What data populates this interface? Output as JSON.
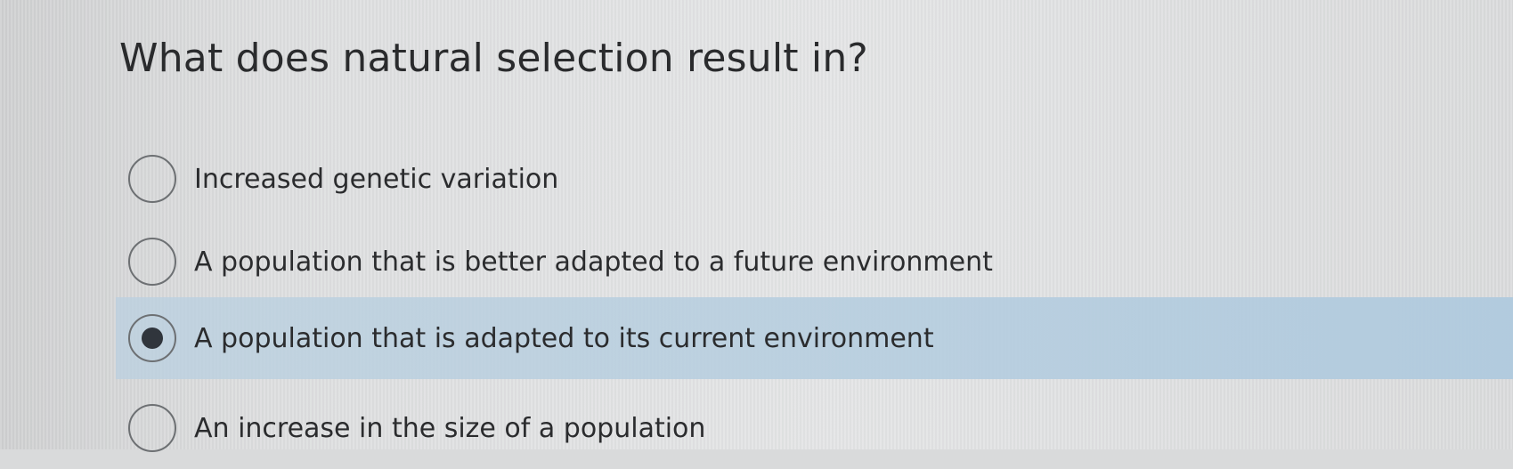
{
  "question": {
    "text": "What does natural selection result in?"
  },
  "options": [
    {
      "label": "Increased genetic variation",
      "selected": false
    },
    {
      "label": "A population that is better adapted to a future environment",
      "selected": false
    },
    {
      "label": "A population that is adapted to its current environment",
      "selected": true
    },
    {
      "label": "An increase in the size of a population",
      "selected": false
    }
  ],
  "colors": {
    "background": "#dcdddf",
    "selected_highlight": "#b8cedf",
    "text": "#2b2c2e",
    "radio_border": "#6d7073",
    "radio_fill": "#30353c"
  }
}
